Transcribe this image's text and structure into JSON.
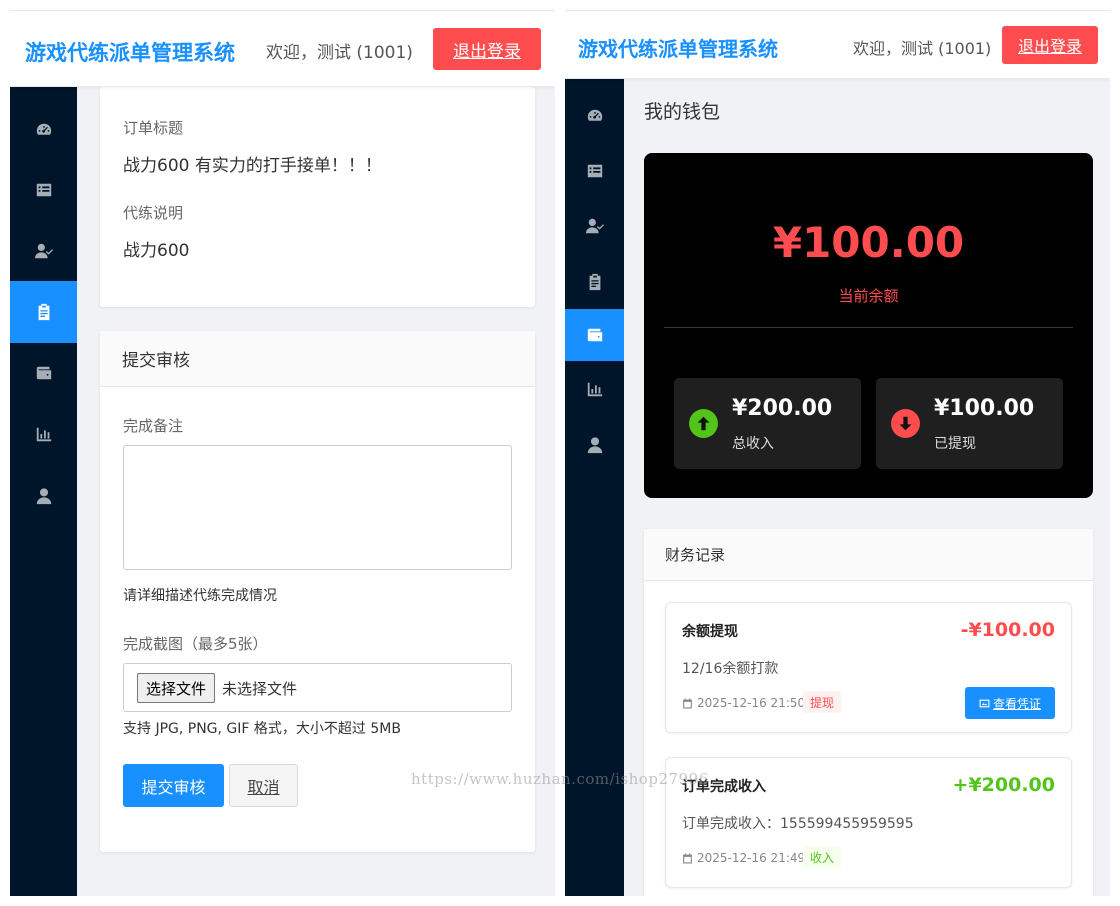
{
  "left": {
    "header": {
      "brand": "游戏代练派单管理系统",
      "welcome": "欢迎，测试 (1001)",
      "logout": "退出登录"
    },
    "sidebar": [
      {
        "icon": "dashboard-icon",
        "active": false
      },
      {
        "icon": "list-icon",
        "active": false
      },
      {
        "icon": "user-check-icon",
        "active": false
      },
      {
        "icon": "clipboard-icon",
        "active": true
      },
      {
        "icon": "wallet-icon",
        "active": false
      },
      {
        "icon": "chart-icon",
        "active": false
      },
      {
        "icon": "user-icon",
        "active": false
      }
    ],
    "order": {
      "title_label": "订单标题",
      "title_value": "战力600 有实力的打手接单！！！",
      "desc_label": "代练说明",
      "desc_value": "战力600"
    },
    "submit": {
      "heading": "提交审核",
      "note_label": "完成备注",
      "note_value": "",
      "note_hint": "请详细描述代练完成情况",
      "shots_label": "完成截图（最多5张）",
      "file_button": "选择文件",
      "file_none": "未选择文件",
      "file_hint": "支持 JPG, PNG, GIF 格式，大小不超过 5MB",
      "submit_button": "提交审核",
      "cancel_button": "取消"
    }
  },
  "right": {
    "header": {
      "brand": "游戏代练派单管理系统",
      "welcome": "欢迎，测试 (1001)",
      "logout": "退出登录"
    },
    "sidebar": [
      {
        "icon": "dashboard-icon",
        "active": false
      },
      {
        "icon": "list-icon",
        "active": false
      },
      {
        "icon": "user-check-icon",
        "active": false
      },
      {
        "icon": "clipboard-icon",
        "active": false
      },
      {
        "icon": "wallet-icon",
        "active": true
      },
      {
        "icon": "chart-icon",
        "active": false
      },
      {
        "icon": "user-icon",
        "active": false
      }
    ],
    "page_title": "我的钱包",
    "wallet": {
      "balance": "¥100.00",
      "balance_label": "当前余额",
      "income": "¥200.00",
      "income_label": "总收入",
      "withdrawn": "¥100.00",
      "withdrawn_label": "已提现"
    },
    "finance": {
      "heading": "财务记录",
      "records": [
        {
          "title": "余额提现",
          "amount": "-¥100.00",
          "desc": "12/16余额打款",
          "time": "2025-12-16 21:50",
          "tag": "提现",
          "action": "查看凭证"
        },
        {
          "title": "订单完成收入",
          "amount": "+¥200.00",
          "desc": "订单完成收入：155599455959595",
          "time": "2025-12-16 21:49",
          "tag": "收入"
        }
      ]
    }
  },
  "colors": {
    "primary": "#1890ff",
    "danger": "#ff4d4f",
    "success": "#52c41a",
    "sidebar": "#001529"
  },
  "watermark": "https://www.huzhan.com/ishop27996"
}
